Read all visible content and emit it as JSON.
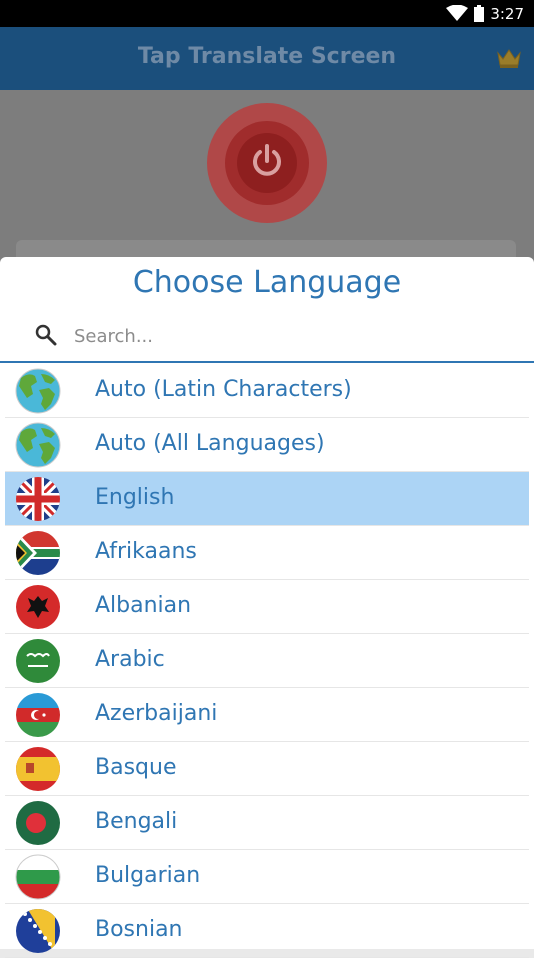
{
  "status_bar": {
    "time": "3:27"
  },
  "app_bar": {
    "title": "Tap Translate Screen"
  },
  "dialog": {
    "title": "Choose Language",
    "search_placeholder": "Search...",
    "languages": [
      {
        "label": "Auto (Latin Characters)",
        "flag": "globe-icon"
      },
      {
        "label": "Auto (All Languages)",
        "flag": "globe-icon"
      },
      {
        "label": "English",
        "flag": "uk-flag-icon",
        "selected": true
      },
      {
        "label": "Afrikaans",
        "flag": "south-africa-flag-icon"
      },
      {
        "label": "Albanian",
        "flag": "albania-flag-icon"
      },
      {
        "label": "Arabic",
        "flag": "saudi-arabia-flag-icon"
      },
      {
        "label": "Azerbaijani",
        "flag": "azerbaijan-flag-icon"
      },
      {
        "label": "Basque",
        "flag": "spain-flag-icon"
      },
      {
        "label": "Bengali",
        "flag": "bangladesh-flag-icon"
      },
      {
        "label": "Bulgarian",
        "flag": "bulgaria-flag-icon"
      },
      {
        "label": "Bosnian",
        "flag": "bosnia-flag-icon"
      }
    ]
  },
  "colors": {
    "accent": "#2f76b3",
    "selected_row": "#acd4f5",
    "app_bar": "#1b4f7c"
  }
}
